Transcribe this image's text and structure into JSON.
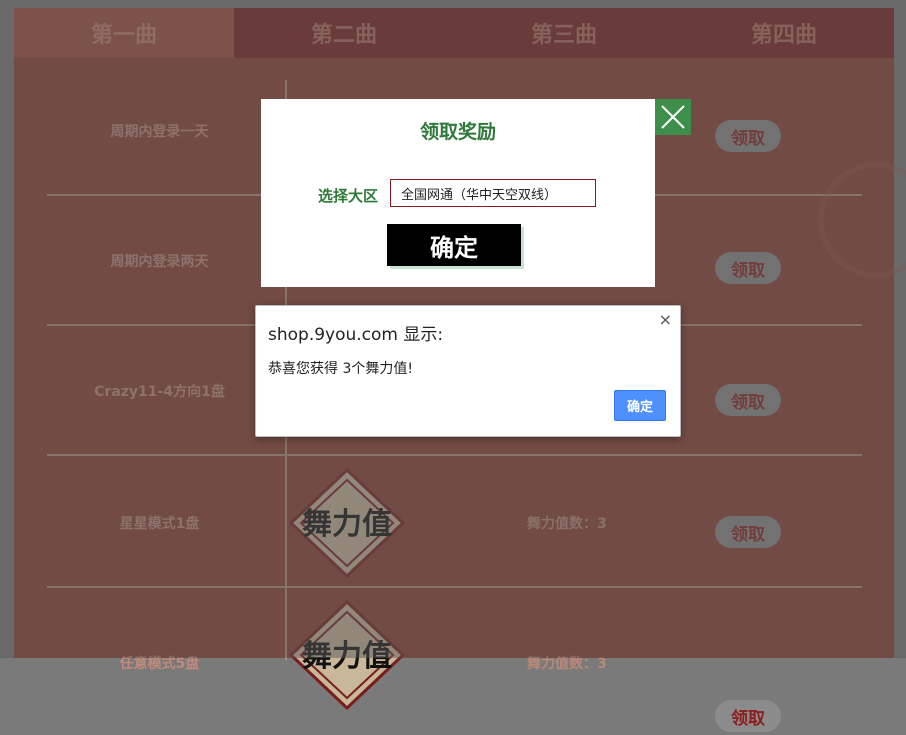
{
  "tabs": [
    "第一曲",
    "第二曲",
    "第三曲",
    "第四曲"
  ],
  "rows": [
    {
      "task": "周期内登录一天",
      "value": "",
      "claim": "领取"
    },
    {
      "task": "周期内登录两天",
      "value": "",
      "claim": "领取"
    },
    {
      "task": "Crazy11-4方向1盘",
      "value": "",
      "claim": "领取"
    },
    {
      "task": "星星模式1盘",
      "value": "舞力值数：3",
      "claim": "领取"
    },
    {
      "task": "任意模式5盘",
      "value": "舞力值数：3",
      "claim": "领取"
    }
  ],
  "reward_emblem_text": "舞力值",
  "modal": {
    "title": "领取奖励",
    "select_label": "选择大区",
    "select_value": "全国网通（华中天空双线）",
    "confirm_label": "确定",
    "close_icon": "close-icon"
  },
  "alert": {
    "title": "shop.9you.com 显示:",
    "message": "恭喜您获得 3个舞力值!",
    "ok_label": "确定",
    "close_glyph": "×"
  },
  "colors": {
    "page_bg": "#8b3c2f",
    "tab_bg": "#7a1d1d",
    "modal_accent": "#2f7a3a",
    "alert_button": "#4d90fe"
  }
}
